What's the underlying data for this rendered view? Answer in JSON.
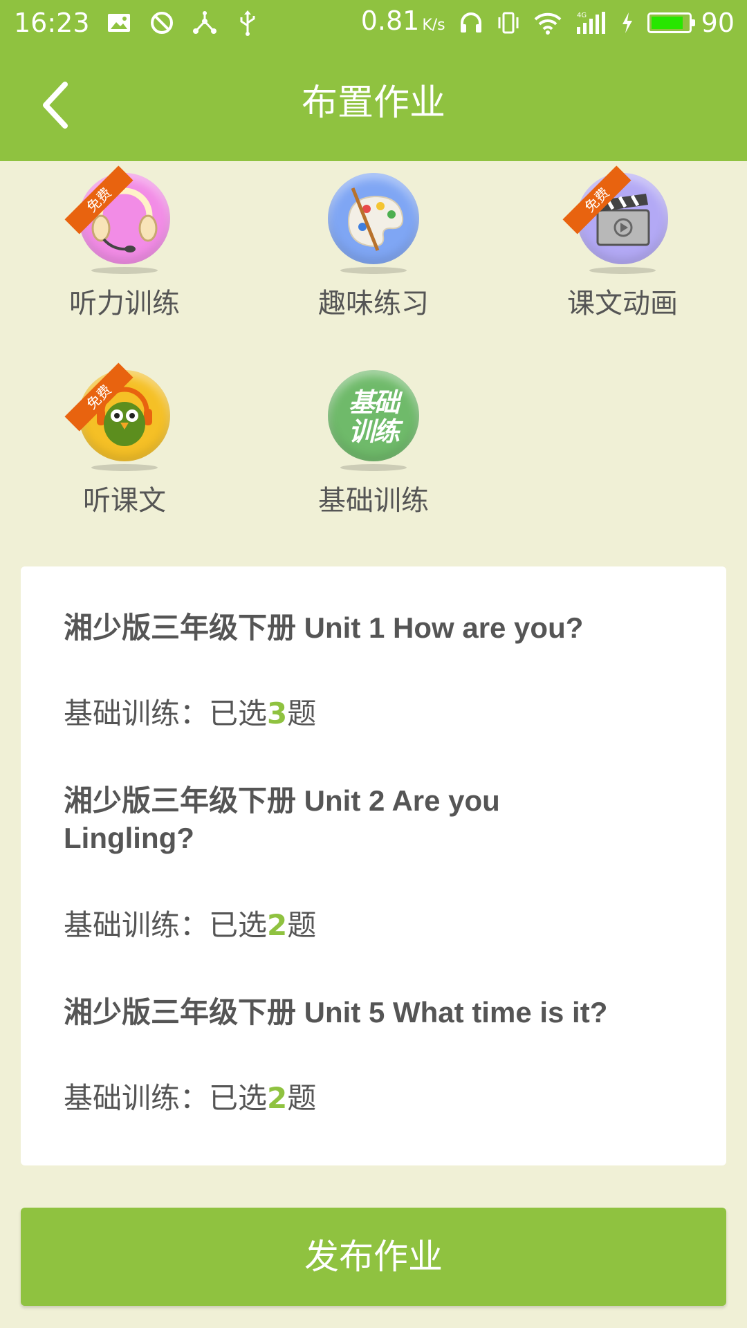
{
  "status_bar": {
    "time": "16:23",
    "speed": "0.81",
    "speed_unit": "K/s",
    "battery_level": "90",
    "battery_fill_percent": 90,
    "icons_left": [
      "image-icon",
      "block-icon",
      "share-network-icon",
      "usb-icon"
    ],
    "icons_right": [
      "headphones-icon",
      "vibrate-icon",
      "wifi-icon",
      "signal-4g-icon",
      "charging-icon",
      "battery-icon"
    ]
  },
  "header": {
    "title": "布置作业",
    "back_icon": "chevron-left-icon"
  },
  "modules": [
    {
      "label": "听力训练",
      "icon": "headset-icon",
      "color": "#f28ce6",
      "badge": "免费"
    },
    {
      "label": "趣味练习",
      "icon": "palette-icon",
      "color": "#7fa6f4",
      "badge": ""
    },
    {
      "label": "课文动画",
      "icon": "clapperboard-icon",
      "color": "#b3a9f5",
      "badge": "免费"
    },
    {
      "label": "听课文",
      "icon": "parrot-headphones-icon",
      "color": "#f5c026",
      "badge": "免费"
    },
    {
      "label": "基础训练",
      "icon": "basic-training-icon",
      "color": "#6fba6a",
      "badge": "",
      "icon_text": "基础训练"
    }
  ],
  "selections": [
    {
      "unit": "湘少版三年级下册 Unit 1 How are you?",
      "prefix": "基础训练：已选",
      "count": "3",
      "suffix": "题"
    },
    {
      "unit": "湘少版三年级下册 Unit 2 Are you Lingling?",
      "prefix": "基础训练：已选",
      "count": "2",
      "suffix": "题"
    },
    {
      "unit": "湘少版三年级下册 Unit 5 What time is it?",
      "prefix": "基础训练：已选",
      "count": "2",
      "suffix": "题"
    }
  ],
  "publish_button": {
    "label": "发布作业"
  },
  "colors": {
    "primary": "#8fc240",
    "background": "#f0f0d6",
    "badge": "#e8630f",
    "text": "#555555"
  }
}
